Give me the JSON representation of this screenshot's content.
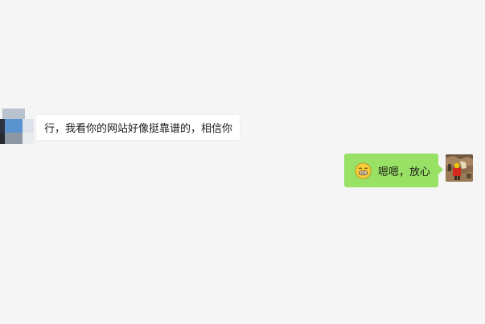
{
  "chat": {
    "messages": [
      {
        "sender": "other",
        "text": "行，我看你的网站好像挺靠谱的，相信你"
      },
      {
        "sender": "self",
        "emoji": "grinning-face-icon",
        "text": "嗯嗯，放心"
      }
    ]
  },
  "colors": {
    "background": "#f5f5f5",
    "incoming_bubble": "#ffffff",
    "outgoing_bubble": "#98e165",
    "emoji_yellow": "#f6cf3c"
  }
}
